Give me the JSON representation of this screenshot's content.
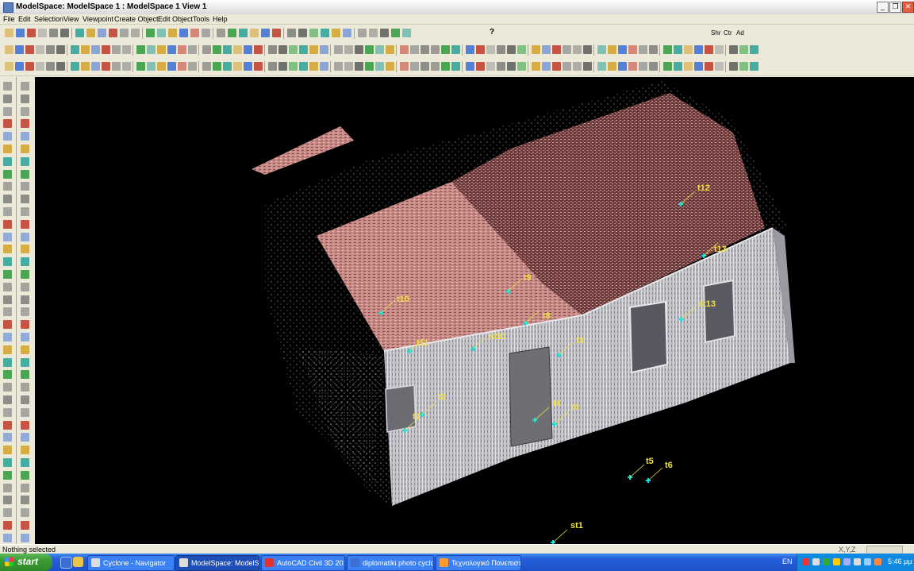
{
  "window": {
    "title": "ModelSpace: ModelSpace 1 : ModelSpace 1 View 1",
    "controls": [
      "_",
      "❐",
      "✕"
    ]
  },
  "menu": [
    "File",
    "Edit",
    "Selection",
    "View",
    "Viewpoint",
    "Create Object",
    "Edit Object",
    "Tools",
    "Help"
  ],
  "toolbar_text": {
    "help_button": "?",
    "shr": "Shr",
    "ctr": "Ctr",
    "ad": "Ad"
  },
  "viewport": {
    "background": "#000000",
    "target_color": "#00e5e5",
    "label_color": "#f0e040",
    "labels": [
      "t12",
      "t13",
      "t9",
      "t10",
      "st13",
      "t8",
      "st11",
      "t11",
      "t3",
      "t2",
      "t7",
      "t4",
      "t4",
      "t5",
      "t6",
      "st1"
    ]
  },
  "status": {
    "text": "Nothing selected",
    "coords_label": "X,Y,Z"
  },
  "taskbar": {
    "start_label": "start",
    "tasks": [
      "Cyclone - Navigator",
      "ModelSpace: ModelSp...",
      "AutoCAD Civil 3D 201...",
      "diplomatiki photo cyclo...",
      "Τεχνολογικό Πανεπιστ..."
    ],
    "language": "EN",
    "clock": "5:46 μμ"
  }
}
